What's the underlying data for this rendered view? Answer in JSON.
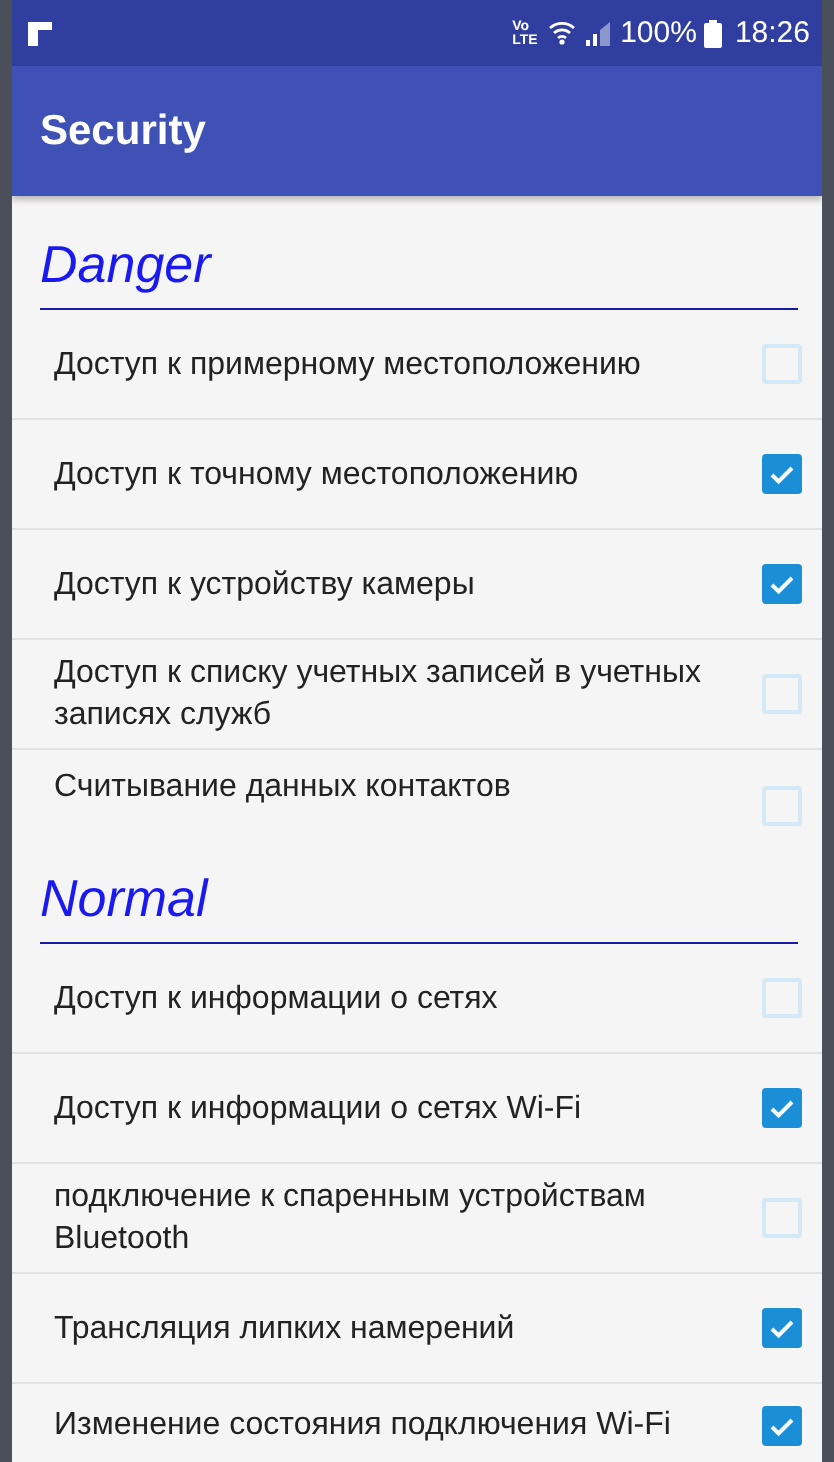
{
  "status_bar": {
    "network": "Vo LTE",
    "battery": "100%",
    "time": "18:26"
  },
  "app_bar": {
    "title": "Security"
  },
  "sections": [
    {
      "title": "Danger",
      "items": [
        {
          "label": "Доступ к примерному местоположению",
          "checked": false
        },
        {
          "label": "Доступ к точному местоположению",
          "checked": true
        },
        {
          "label": "Доступ к устройству камеры",
          "checked": true
        },
        {
          "label": "Доступ к списку учетных записей в учетных записях служб",
          "checked": false
        },
        {
          "label": "Считывание данных контактов",
          "checked": false
        }
      ]
    },
    {
      "title": "Normal",
      "items": [
        {
          "label": "Доступ к информации о сетях",
          "checked": false
        },
        {
          "label": "Доступ к информации о сетях Wi-Fi",
          "checked": true
        },
        {
          "label": "подключение к спаренным устройствам Bluetooth",
          "checked": false
        },
        {
          "label": "Трансляция липких намерений",
          "checked": true
        },
        {
          "label": "Изменение состояния подключения Wi-Fi",
          "checked": true
        }
      ]
    }
  ]
}
